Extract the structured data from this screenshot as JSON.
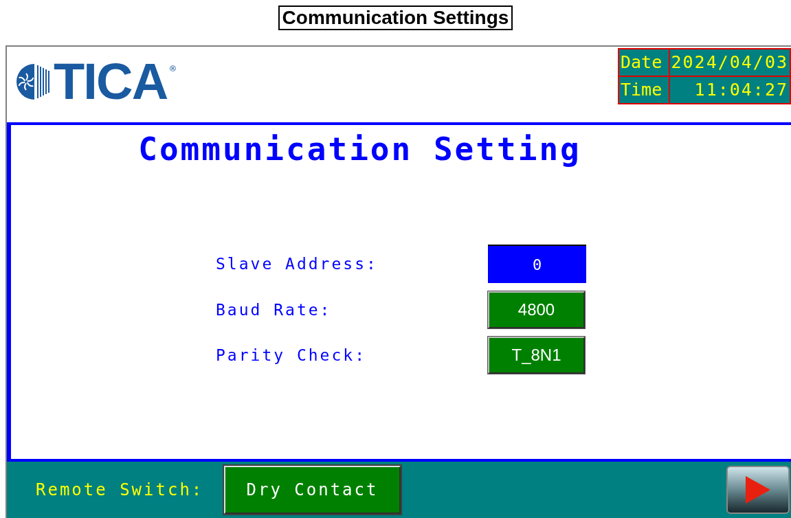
{
  "page_title": "Communication Settings",
  "header": {
    "logo": {
      "text": "TICA",
      "mark": "®"
    },
    "clock": [
      {
        "label": "Date",
        "value": "2024/04/03"
      },
      {
        "label": "Time",
        "value": "11:04:27"
      }
    ]
  },
  "screen_title": "Communication Setting",
  "settings": [
    {
      "label": "Slave Address:",
      "value": "0",
      "kind": "input"
    },
    {
      "label": "Baud Rate:",
      "value": "4800",
      "kind": "button"
    },
    {
      "label": "Parity Check:",
      "value": "T_8N1",
      "kind": "button"
    }
  ],
  "footer": {
    "label": "Remote Switch:",
    "value": "Dry Contact"
  }
}
